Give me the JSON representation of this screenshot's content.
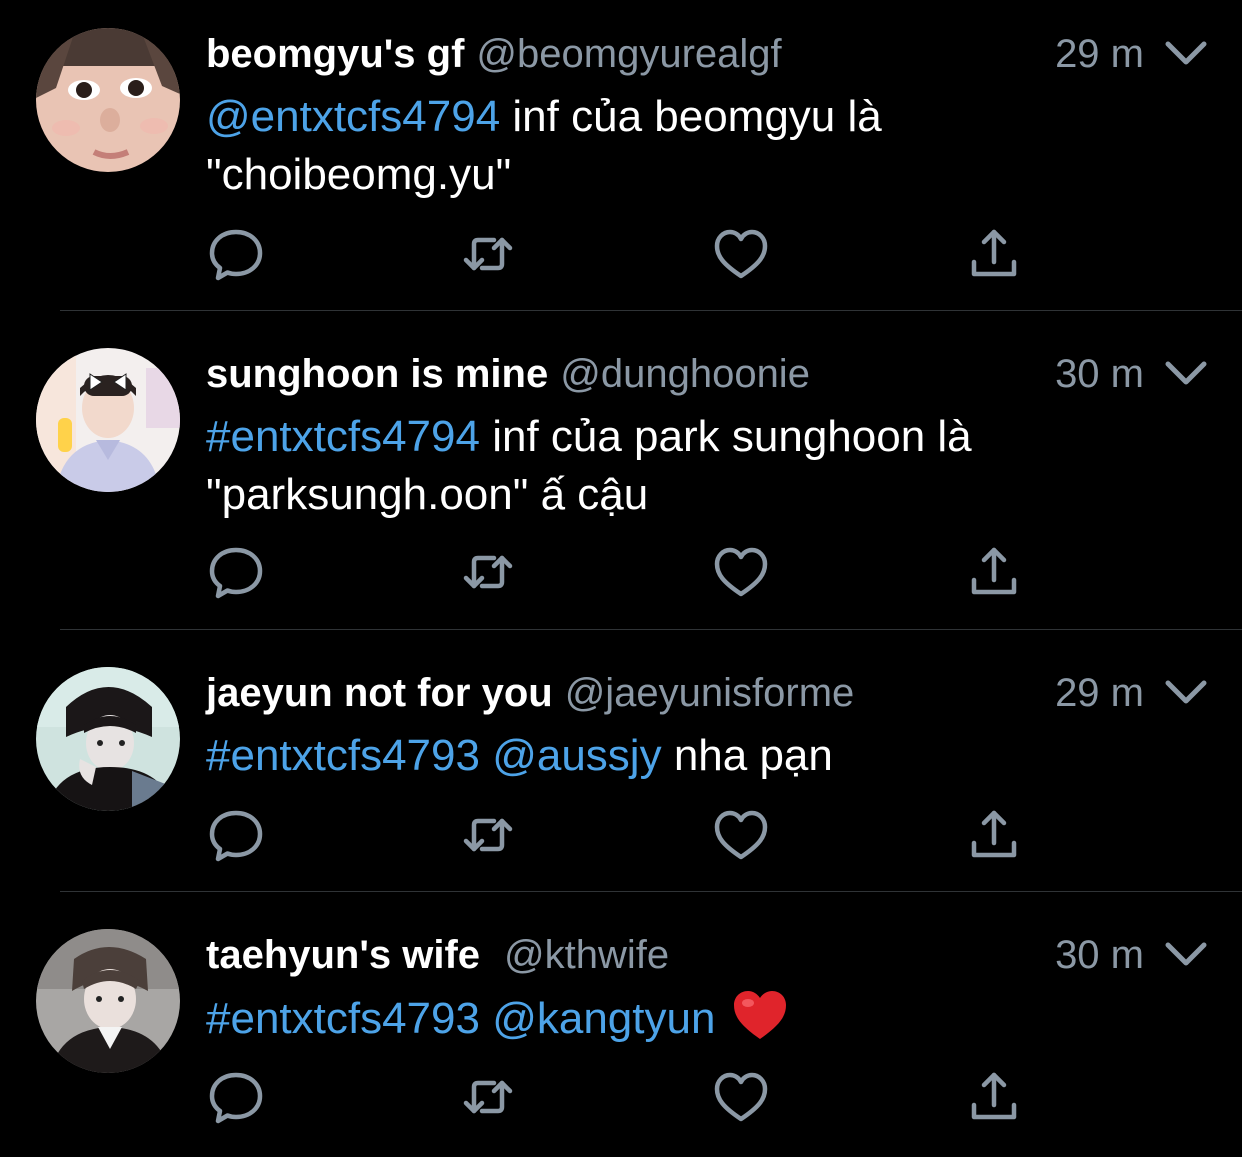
{
  "colors": {
    "background": "#000000",
    "text": "#ffffff",
    "muted": "#8b98a5",
    "link": "#4da3e8",
    "divider": "#2f3336",
    "heart_emoji": "#e0242b"
  },
  "tweets": [
    {
      "display_name": "beomgyu's gf",
      "handle": "@beomgyurealgf",
      "time": "29 m",
      "line1_link": "@entxtcfs4794",
      "line1_text": " inf của beomgyu là",
      "line2_text": "\"choibeomg.yu\""
    },
    {
      "display_name": "sunghoon is mine",
      "handle": "@dunghoonie",
      "time": "30 m",
      "line1_link": "#entxtcfs4794",
      "line1_text": " inf của park sunghoon là",
      "line2_text": "\"parksungh.oon\" ấ cậu"
    },
    {
      "display_name": "jaeyun not for you",
      "handle": "@jaeyunisforme",
      "time": "29 m",
      "line1_link": "#entxtcfs4793",
      "line1_link2": "@aussjy",
      "line1_text": " nha pạn"
    },
    {
      "display_name": "taehyun's wife",
      "handle": "@kthwife",
      "time": "30 m",
      "line1_link": "#entxtcfs4793",
      "line1_link2": "@kangtyun",
      "emoji": "red-heart-emoji"
    }
  ],
  "icons": {
    "reply": "reply-icon",
    "retweet": "retweet-icon",
    "like": "like-icon",
    "share": "share-icon",
    "caret": "chevron-down-icon"
  }
}
